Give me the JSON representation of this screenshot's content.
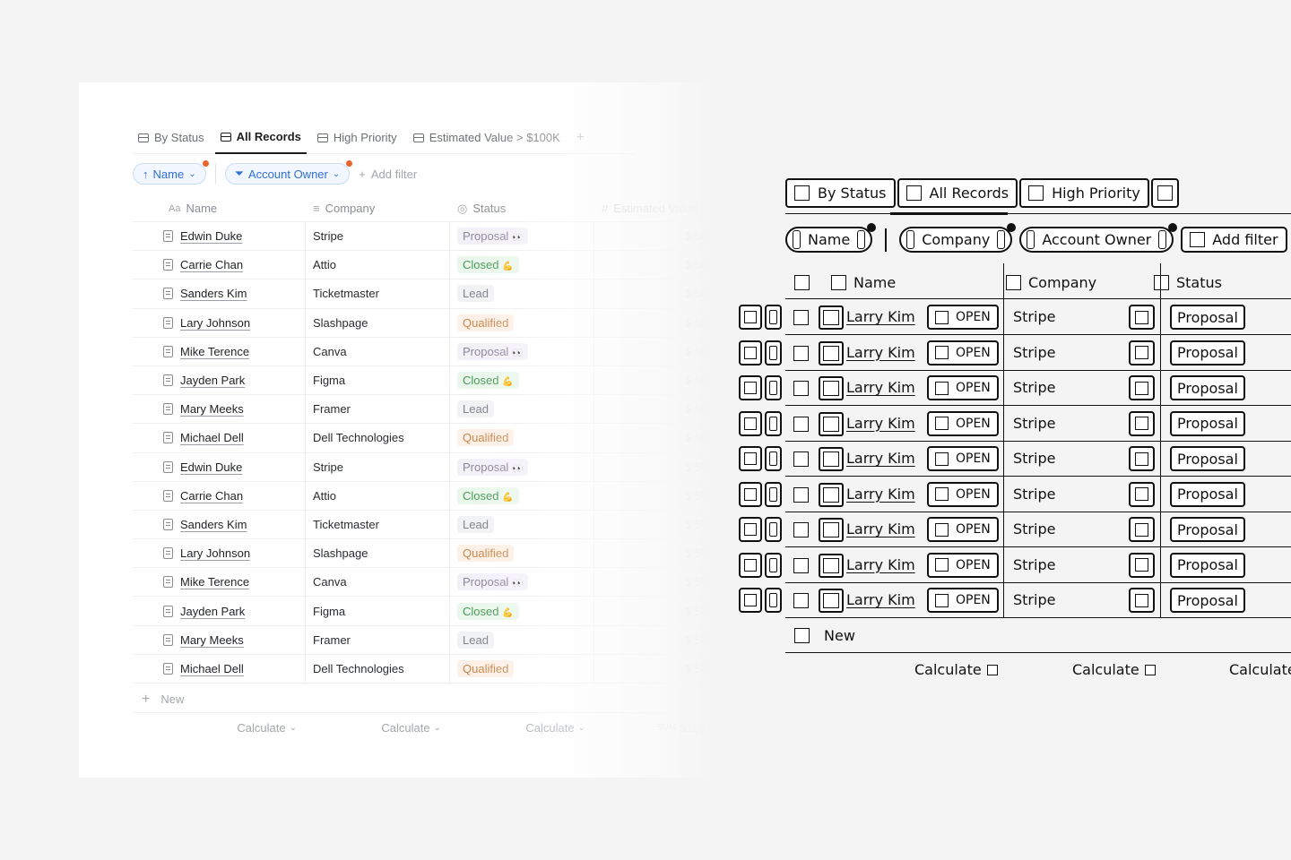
{
  "left": {
    "views": [
      {
        "label": "By Status",
        "icon": "kanban-icon",
        "active": false
      },
      {
        "label": "All Records",
        "icon": "table-icon",
        "active": true
      },
      {
        "label": "High Priority",
        "icon": "table-icon",
        "active": false
      },
      {
        "label": "Estimated Value > $100K",
        "icon": "table-icon",
        "active": false
      }
    ],
    "add_view_label": "+",
    "filters": {
      "sort_chip": "Name",
      "owner_chip": "Account Owner",
      "add_filter": "Add filter"
    },
    "columns": {
      "name": "Name",
      "company": "Company",
      "status": "Status",
      "value": "Estimated Value"
    },
    "column_icons": {
      "name": "Aa",
      "company": "≡",
      "status": "◎",
      "value": "#"
    },
    "rows": [
      {
        "name": "Edwin Duke",
        "company": "Stripe",
        "status": "Proposal",
        "status_emoji": "👀",
        "status_kind": "proposal",
        "value": "$ 50,0"
      },
      {
        "name": "Carrie Chan",
        "company": "Attio",
        "status": "Closed",
        "status_emoji": "💪",
        "status_kind": "closed",
        "value": "$ 50,0"
      },
      {
        "name": "Sanders Kim",
        "company": "Ticketmaster",
        "status": "Lead",
        "status_emoji": "",
        "status_kind": "lead",
        "value": "$ 50,0"
      },
      {
        "name": "Lary Johnson",
        "company": "Slashpage",
        "status": "Qualified",
        "status_emoji": "",
        "status_kind": "qualified",
        "value": "$ 50,0"
      },
      {
        "name": "Mike Terence",
        "company": "Canva",
        "status": "Proposal",
        "status_emoji": "👀",
        "status_kind": "proposal",
        "value": "$ 50,0"
      },
      {
        "name": "Jayden Park",
        "company": "Figma",
        "status": "Closed",
        "status_emoji": "💪",
        "status_kind": "closed",
        "value": "$ 50,0"
      },
      {
        "name": "Mary Meeks",
        "company": "Framer",
        "status": "Lead",
        "status_emoji": "",
        "status_kind": "lead",
        "value": "$ 50,0"
      },
      {
        "name": "Michael Dell",
        "company": "Dell Technologies",
        "status": "Qualified",
        "status_emoji": "",
        "status_kind": "qualified",
        "value": "$ 50,0"
      },
      {
        "name": "Edwin Duke",
        "company": "Stripe",
        "status": "Proposal",
        "status_emoji": "👀",
        "status_kind": "proposal",
        "value": "$ 50,0"
      },
      {
        "name": "Carrie Chan",
        "company": "Attio",
        "status": "Closed",
        "status_emoji": "💪",
        "status_kind": "closed",
        "value": "$ 50,0"
      },
      {
        "name": "Sanders Kim",
        "company": "Ticketmaster",
        "status": "Lead",
        "status_emoji": "",
        "status_kind": "lead",
        "value": "$ 50,0"
      },
      {
        "name": "Lary Johnson",
        "company": "Slashpage",
        "status": "Qualified",
        "status_emoji": "",
        "status_kind": "qualified",
        "value": "$ 50,0"
      },
      {
        "name": "Mike Terence",
        "company": "Canva",
        "status": "Proposal",
        "status_emoji": "👀",
        "status_kind": "proposal",
        "value": "$ 50,0"
      },
      {
        "name": "Jayden Park",
        "company": "Figma",
        "status": "Closed",
        "status_emoji": "💪",
        "status_kind": "closed",
        "value": "$ 50,0"
      },
      {
        "name": "Mary Meeks",
        "company": "Framer",
        "status": "Lead",
        "status_emoji": "",
        "status_kind": "lead",
        "value": "$ 50,0"
      },
      {
        "name": "Michael Dell",
        "company": "Dell Technologies",
        "status": "Qualified",
        "status_emoji": "",
        "status_kind": "qualified",
        "value": "$ 50,0"
      }
    ],
    "new_label": "New",
    "calculate": [
      "Calculate",
      "Calculate",
      "Calculate"
    ],
    "sum_label": "SUM",
    "sum_value": "$128,0"
  },
  "wire": {
    "tabs": [
      "By Status",
      "All Records",
      "High Priority"
    ],
    "filters": [
      "Name",
      "Company",
      "Account Owner"
    ],
    "add_filter": "Add filter",
    "columns": [
      "Name",
      "Company",
      "Status"
    ],
    "row": {
      "name": "Larry Kim",
      "open": "OPEN",
      "company": "Stripe",
      "status": "Proposal"
    },
    "row_count": 9,
    "new_label": "New",
    "calculate": [
      "Calculate",
      "Calculate",
      "Calculate"
    ]
  }
}
